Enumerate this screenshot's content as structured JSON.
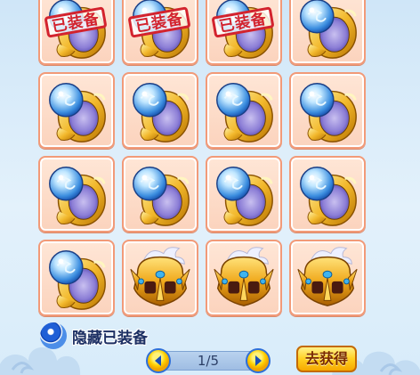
{
  "inventory": {
    "equipped_stamp_text": "已装备",
    "slots": [
      {
        "item": "ring-icon",
        "equipped": true
      },
      {
        "item": "ring-icon",
        "equipped": true
      },
      {
        "item": "ring-icon",
        "equipped": true
      },
      {
        "item": "ring-icon",
        "equipped": false
      },
      {
        "item": "ring-icon",
        "equipped": false
      },
      {
        "item": "ring-icon",
        "equipped": false
      },
      {
        "item": "ring-icon",
        "equipped": false
      },
      {
        "item": "ring-icon",
        "equipped": false
      },
      {
        "item": "ring-icon",
        "equipped": false
      },
      {
        "item": "ring-icon",
        "equipped": false
      },
      {
        "item": "ring-icon",
        "equipped": false
      },
      {
        "item": "ring-icon",
        "equipped": false
      },
      {
        "item": "ring-icon",
        "equipped": false
      },
      {
        "item": "helmet-icon",
        "equipped": false
      },
      {
        "item": "helmet-icon",
        "equipped": false
      },
      {
        "item": "helmet-icon",
        "equipped": false
      }
    ]
  },
  "controls": {
    "hide_equipped_label": "隐藏已装备",
    "hide_equipped_checked": true,
    "page_indicator": "1/5",
    "get_button_label": "去获得"
  },
  "colors": {
    "panel_background": "#d8ecfa",
    "slot_fill": "#fbd3bd",
    "slot_border": "#f29a78",
    "stamp_red": "#d3232e",
    "radio_blue": "#1f5fd6",
    "button_gold": "#ffd021"
  }
}
